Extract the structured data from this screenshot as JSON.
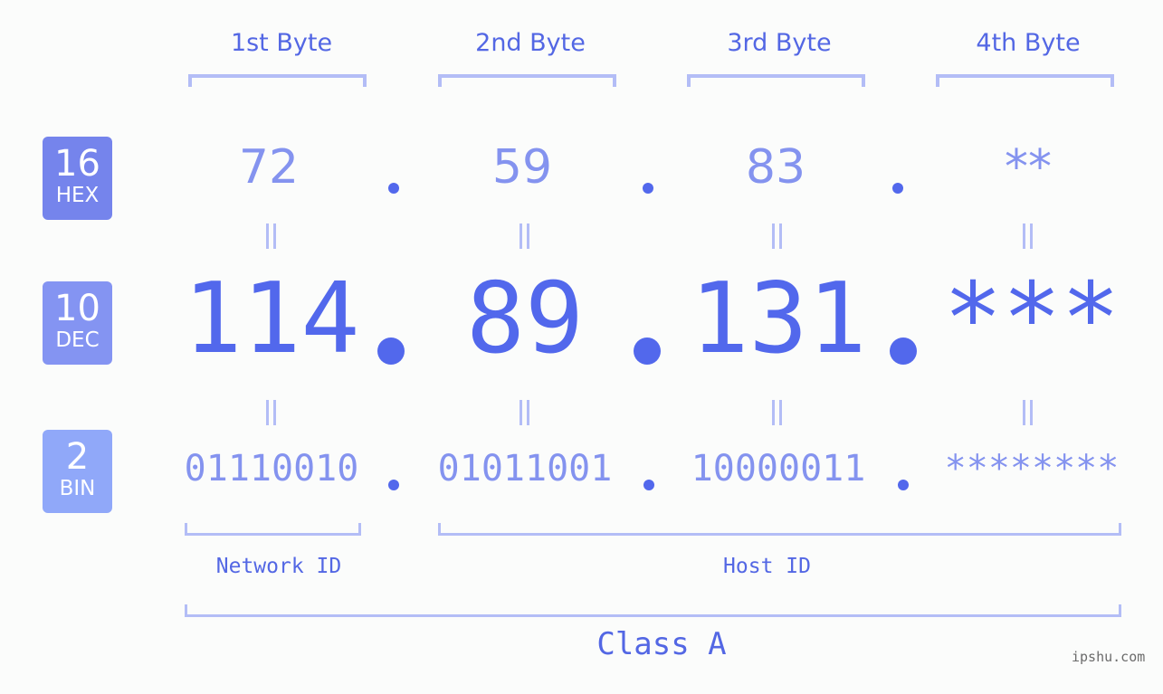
{
  "byte_headers": [
    "1st Byte",
    "2nd Byte",
    "3rd Byte",
    "4th Byte"
  ],
  "badges": {
    "hex": {
      "base": "16",
      "label": "HEX",
      "color": "#7584ec"
    },
    "dec": {
      "base": "10",
      "label": "DEC",
      "color": "#8494f2"
    },
    "bin": {
      "base": "2",
      "label": "BIN",
      "color": "#90a8f9"
    }
  },
  "hex_values": [
    "72",
    "59",
    "83",
    "**"
  ],
  "dec_values": [
    "114",
    "89",
    "131",
    "***"
  ],
  "bin_values": [
    "01110010",
    "01011001",
    "10000011",
    "********"
  ],
  "segments": {
    "network_label": "Network ID",
    "host_label": "Host ID",
    "class_label": "Class A"
  },
  "watermark": "ipshu.com",
  "colors": {
    "accent": "#5268ec",
    "light": "#8493ef",
    "bracket": "#b3bdf6"
  }
}
